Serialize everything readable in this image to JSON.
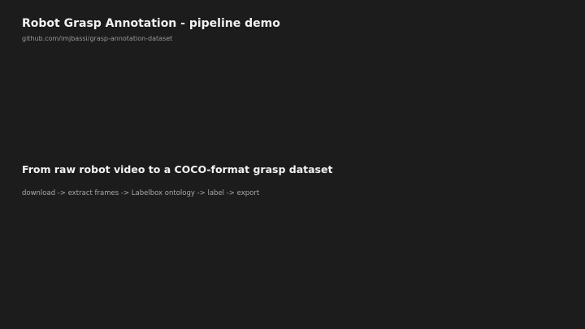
{
  "slide": {
    "title": "Robot Grasp Annotation  -  pipeline demo",
    "repo_link": "github.com/imjbassi/grasp-annotation-dataset",
    "heading": "From raw robot video to a COCO-format grasp dataset",
    "pipeline_steps": "download  ->  extract frames  ->  Labelbox ontology  ->  label  ->  export"
  },
  "colors": {
    "background": "#1c1c1c",
    "title_text": "#f2f2f2",
    "muted_text": "#9a9a9a"
  }
}
